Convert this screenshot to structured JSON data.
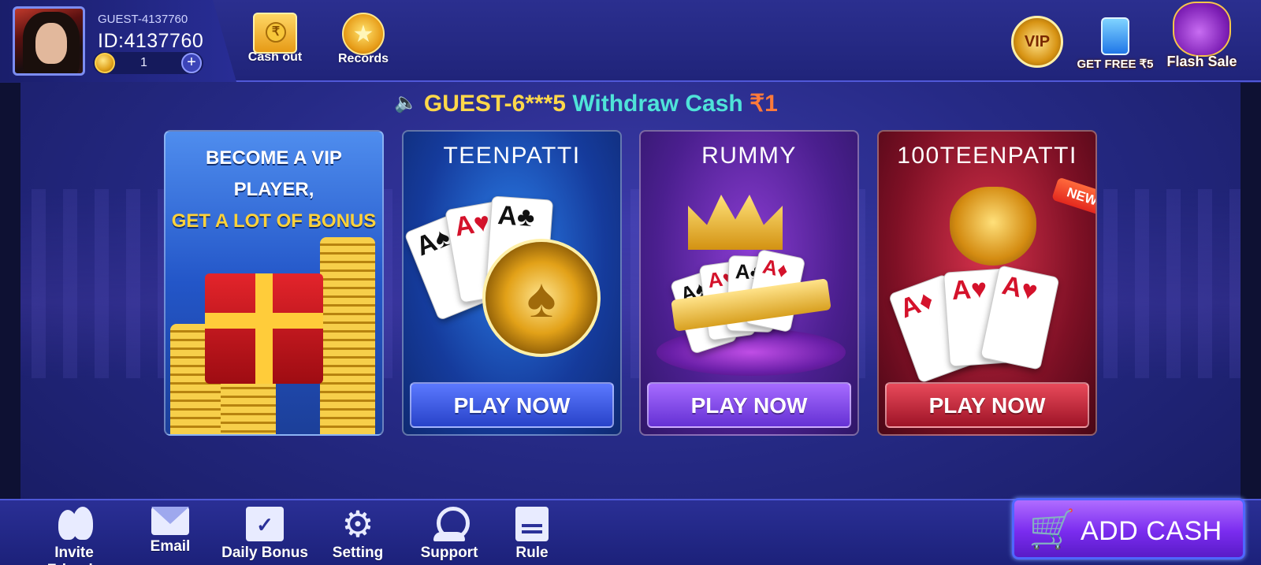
{
  "profile": {
    "name": "GUEST-4137760",
    "id": "ID:4137760",
    "coins": "1",
    "add_icon": "+"
  },
  "top_actions": {
    "cashout_label": "Cash out",
    "cashout_icon_glyph": "₹",
    "records_label": "Records",
    "vip_label": "VIP",
    "get_free_label": "GET FREE ₹5",
    "flash_sale_label": "Flash Sale"
  },
  "marquee": {
    "user": "GUEST-6***5",
    "text": "Withdraw Cash",
    "amount": "₹1"
  },
  "games": {
    "vip": {
      "line1": "BECOME A VIP PLAYER,",
      "line2": "GET A LOT OF BONUS"
    },
    "teenpatti": {
      "title": "TEENPATTI",
      "button": "PLAY NOW"
    },
    "rummy": {
      "title": "RUMMY",
      "button": "PLAY NOW"
    },
    "teenpatti100": {
      "title": "100TEENPATTI",
      "button": "PLAY NOW",
      "badge": "NEW"
    }
  },
  "card_glyphs": {
    "ace": "A"
  },
  "bottom_nav": {
    "invite": "Invite Friends",
    "email": "Email",
    "daily_bonus": "Daily Bonus",
    "setting": "Setting",
    "support": "Support",
    "rule": "Rule",
    "setting_glyph": "⚙",
    "cart_glyph": "🛒"
  },
  "add_cash": {
    "label": "ADD CASH"
  },
  "colors": {
    "marquee_user": "#ffd84a",
    "marquee_text": "#4fe3d8",
    "marquee_amount": "#ff7a3a",
    "add_cash": "#7a2cef"
  },
  "icons": [
    "avatar",
    "coin-icon",
    "plus-icon",
    "cashout-icon",
    "records-icon",
    "vip-icon",
    "phone-icon",
    "money-bag-icon",
    "speaker-icon",
    "friends-icon",
    "email-icon",
    "calendar-icon",
    "gear-icon",
    "support-icon",
    "rule-icon",
    "cart-icon"
  ]
}
